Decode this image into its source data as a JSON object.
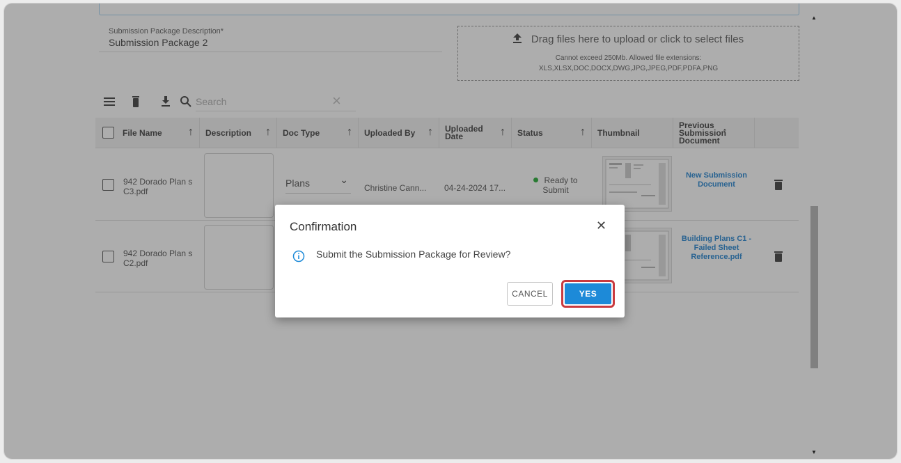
{
  "form": {
    "desc_label": "Submission Package Description*",
    "desc_value": "Submission Package 2"
  },
  "dropzone": {
    "title": "Drag files here to upload or click to select files",
    "line1": "Cannot exceed 250Mb. Allowed file extensions:",
    "line2": "XLS,XLSX,DOC,DOCX,DWG,JPG,JPEG,PDF,PDFA,PNG",
    "icon": "upload-icon"
  },
  "toolbar": {
    "search_placeholder": "Search",
    "icons": [
      "menu-icon",
      "trash-icon",
      "download-icon",
      "search-icon",
      "close-icon"
    ]
  },
  "table": {
    "headers": {
      "file_name": "File Name",
      "description": "Description",
      "doc_type": "Doc Type",
      "uploaded_by": "Uploaded By",
      "uploaded_date": "Uploaded Date",
      "status": "Status",
      "thumbnail": "Thumbnail",
      "previous": "Previous Submission Document"
    },
    "rows": [
      {
        "file_name": "942 Dorado Plan s C3.pdf",
        "doc_type": "Plans",
        "uploaded_by": "Christine Cann...",
        "uploaded_date": "04-24-2024 17...",
        "status": "Ready to Submit",
        "previous": "New Submission Document"
      },
      {
        "file_name": "942 Dorado Plan s C2.pdf",
        "previous": "Building Plans C1 - Failed Sheet Reference.pdf"
      }
    ]
  },
  "dialog": {
    "title": "Confirmation",
    "message": "Submit the Submission Package for Review?",
    "cancel_label": "CANCEL",
    "yes_label": "YES"
  },
  "colors": {
    "accent": "#1d8ad8",
    "link": "#3d92d6",
    "status_ready": "#3cb44b",
    "highlight": "#c93a3f"
  }
}
